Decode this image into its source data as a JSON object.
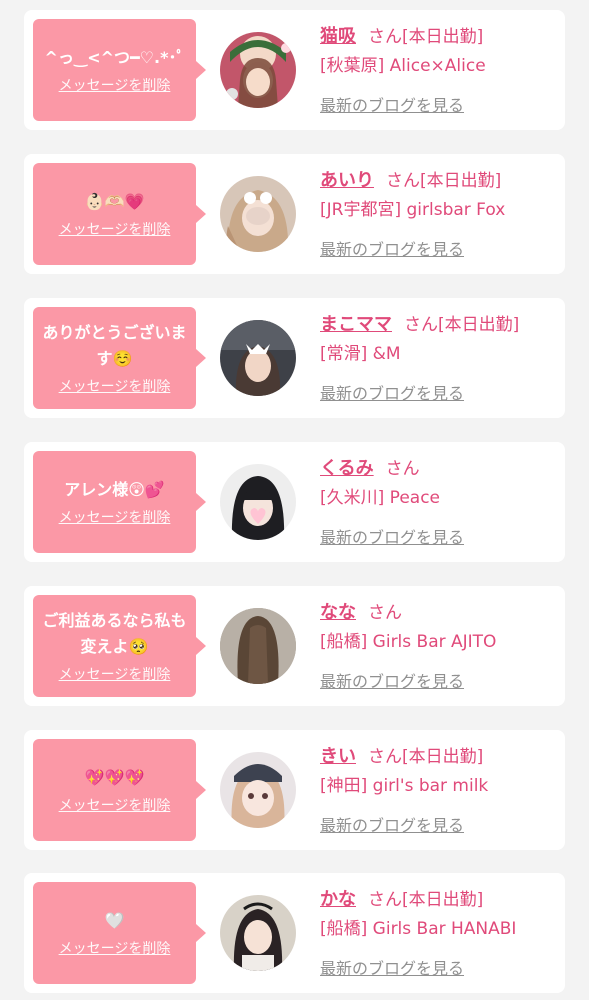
{
  "colors": {
    "bubble": "#fb98a6",
    "name_pink": "#e04a7a",
    "link_gray": "#909090",
    "card_bg": "#ffffff",
    "page_bg": "#f3f3f3"
  },
  "cards": [
    {
      "message": "^っ‿<^つ━♡.*･ﾟ",
      "delete_label": "メッセージを削除",
      "name": "猫吸",
      "honorific": "さん",
      "status": "[本日出勤]",
      "shop": "[秋葉原] Alice×Alice",
      "blog_label": "最新のブログを見る"
    },
    {
      "message": "👶🏻🫶🏻💗",
      "delete_label": "メッセージを削除",
      "name": "あいり",
      "honorific": "さん",
      "status": "[本日出勤]",
      "shop": "[JR宇都宮] girlsbar Fox",
      "blog_label": "最新のブログを見る"
    },
    {
      "message": "ありがとうございます☺️",
      "delete_label": "メッセージを削除",
      "name": "まこママ",
      "honorific": "さん",
      "status": "[本日出勤]",
      "shop": "[常滑] &M",
      "blog_label": "最新のブログを見る"
    },
    {
      "message": "アレン様😲💕",
      "delete_label": "メッセージを削除",
      "name": "くるみ",
      "honorific": "さん",
      "status": "",
      "shop": "[久米川] Peace",
      "blog_label": "最新のブログを見る"
    },
    {
      "message": "ご利益あるなら私も変えよ🥺",
      "delete_label": "メッセージを削除",
      "name": "なな",
      "honorific": "さん",
      "status": "",
      "shop": "[船橋] Girls Bar AJITO",
      "blog_label": "最新のブログを見る"
    },
    {
      "message": "💖💖💖",
      "delete_label": "メッセージを削除",
      "name": "きい",
      "honorific": "さん",
      "status": "[本日出勤]",
      "shop": "[神田] girl's bar milk",
      "blog_label": "最新のブログを見る"
    },
    {
      "message": "🤍",
      "delete_label": "メッセージを削除",
      "name": "かな",
      "honorific": "さん",
      "status": "[本日出勤]",
      "shop": "[船橋] Girls Bar HANABI",
      "blog_label": "最新のブログを見る"
    }
  ]
}
